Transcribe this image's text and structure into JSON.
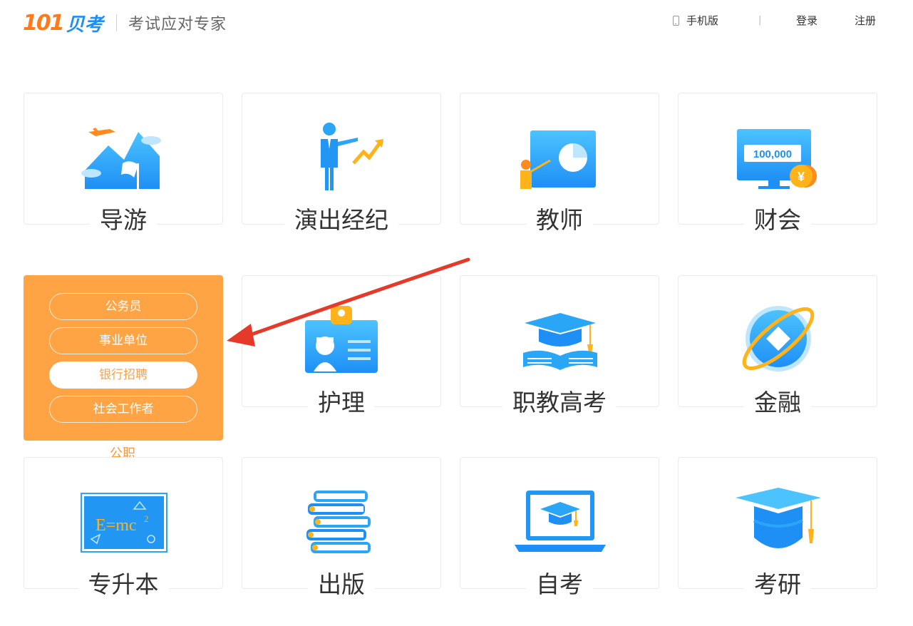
{
  "header": {
    "logo_number": "101",
    "logo_text": "贝考",
    "slogan": "考试应对专家",
    "nav": {
      "mobile": "手机版",
      "divider": "|",
      "login": "登录",
      "register": "注册"
    }
  },
  "categories": [
    {
      "label": "导游",
      "icon": "mountain-plane-icon"
    },
    {
      "label": "演出经纪",
      "icon": "presenter-chart-icon"
    },
    {
      "label": "教师",
      "icon": "teacher-board-icon"
    },
    {
      "label": "财会",
      "icon": "monitor-money-icon"
    },
    {
      "label": "公职",
      "icon": "civil-service-icon",
      "sub_items": [
        "公务员",
        "事业单位",
        "银行招聘",
        "社会工作者"
      ],
      "selected_sub": "银行招聘"
    },
    {
      "label": "护理",
      "icon": "nurse-badge-icon"
    },
    {
      "label": "职教高考",
      "icon": "cap-book-icon"
    },
    {
      "label": "金融",
      "icon": "finance-globe-icon"
    },
    {
      "label": "专升本",
      "icon": "formula-board-icon"
    },
    {
      "label": "出版",
      "icon": "book-stack-icon"
    },
    {
      "label": "自考",
      "icon": "laptop-cap-icon"
    },
    {
      "label": "考研",
      "icon": "graduation-cap-icon"
    }
  ],
  "icon_text": {
    "finance_amount": "100,000",
    "yuan_symbol": "¥",
    "formula": "E=mc",
    "formula_exp": "2"
  },
  "colors": {
    "brand_orange": "#ff7a1a",
    "brand_blue": "#1e8ff5",
    "active_card": "#ffa445",
    "arrow": "#e53a2a"
  }
}
